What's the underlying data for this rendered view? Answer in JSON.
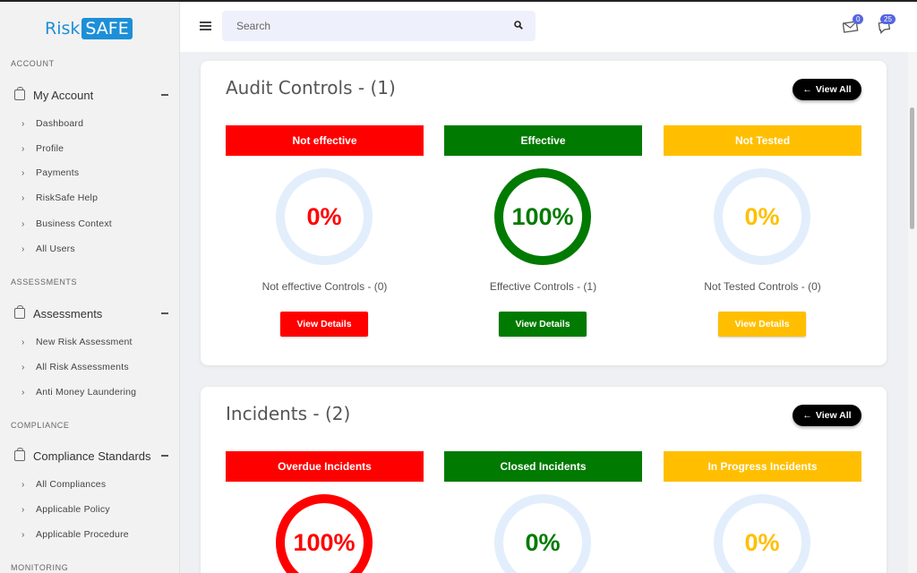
{
  "brand": {
    "part1": "Risk",
    "part2": "SAFE"
  },
  "header": {
    "search_placeholder": "Search",
    "mail_count": "0",
    "chat_count": "25"
  },
  "sidebar": {
    "sections": [
      {
        "label": "ACCOUNT",
        "group": "My Account",
        "items": [
          "Dashboard",
          "Profile",
          "Payments",
          "RiskSafe Help",
          "Business Context",
          "All Users"
        ]
      },
      {
        "label": "ASSESSMENTS",
        "group": "Assessments",
        "items": [
          "New Risk Assessment",
          "All Risk Assessments",
          "Anti Money Laundering"
        ]
      },
      {
        "label": "COMPLIANCE",
        "group": "Compliance Standards",
        "items": [
          "All Compliances",
          "Applicable Policy",
          "Applicable Procedure"
        ]
      },
      {
        "label": "MONITORING"
      }
    ]
  },
  "colors": {
    "red": "#ff0000",
    "green": "#007a00",
    "amber": "#ffbf00",
    "ring_empty": "#e2eefb",
    "accent": "#1d8fd8"
  },
  "audit": {
    "title": "Audit Controls - (1)",
    "view_all": "View All",
    "columns": [
      {
        "header": "Not effective",
        "percent_text": "0%",
        "percent": 0,
        "label": "Not effective Controls - (0)",
        "button": "View Details"
      },
      {
        "header": "Effective",
        "percent_text": "100%",
        "percent": 100,
        "label": "Effective Controls - (1)",
        "button": "View Details"
      },
      {
        "header": "Not Tested",
        "percent_text": "0%",
        "percent": 0,
        "label": "Not Tested Controls - (0)",
        "button": "View Details"
      }
    ]
  },
  "incidents": {
    "title": "Incidents - (2)",
    "view_all": "View All",
    "columns": [
      {
        "header": "Overdue Incidents",
        "percent_text": "100%",
        "percent": 100
      },
      {
        "header": "Closed Incidents",
        "percent_text": "0%",
        "percent": 0
      },
      {
        "header": "In Progress Incidents",
        "percent_text": "0%",
        "percent": 0
      }
    ]
  }
}
